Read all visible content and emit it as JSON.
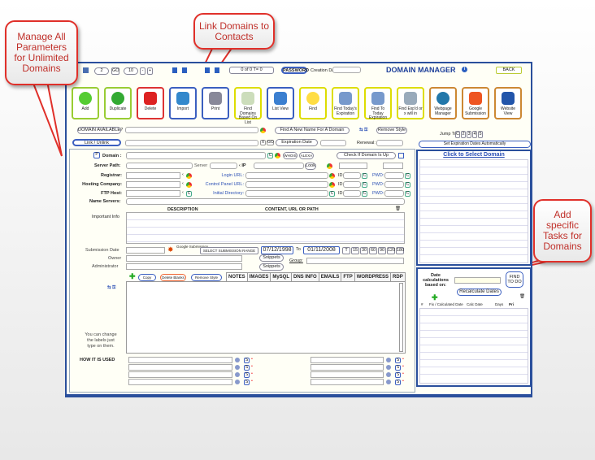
{
  "callouts": {
    "manage": "Manage All Parameters for Unlimited Domains",
    "link": "Link Domains to Contacts",
    "tasks": "Add specific Tasks for Domains"
  },
  "topbar": {
    "page": "2",
    "go": "GO",
    "count": "10",
    "minus": "-",
    "plus": "+",
    "record_status": "0 of 0 T= 0",
    "password": "PASSWORD",
    "creation_date_label": "Creation Date:",
    "title": "DOMAIN MANAGER",
    "info": "i",
    "back": "BACK"
  },
  "toolbar": [
    {
      "label": "Add",
      "icon": "plus-icon",
      "color": "#9c3"
    },
    {
      "label": "Duplicate",
      "icon": "globe-dots-icon",
      "color": "#9c3"
    },
    {
      "label": "Delete",
      "icon": "trash-icon",
      "color": "#d33"
    },
    {
      "label": "Import",
      "icon": "import-icon",
      "color": "#3b5fc0"
    },
    {
      "label": "Print",
      "icon": "printer-icon",
      "color": "#3b5fc0"
    },
    {
      "label": "Find Domains Based On List",
      "icon": "clipboard-icon",
      "color": "#dd0"
    },
    {
      "label": "List View",
      "icon": "window-icon",
      "color": "#3b5fc0"
    },
    {
      "label": "Find",
      "icon": "magnifier-icon",
      "color": "#dd0"
    },
    {
      "label": "Find Today's Expiration",
      "icon": "calendar-icon",
      "color": "#dd0"
    },
    {
      "label": "Find To Today Expiration",
      "icon": "calendar-icon",
      "color": "#dd0"
    },
    {
      "label": "Find Exp'd or  x  will in",
      "icon": "calendar-clock-icon",
      "color": "#dd0"
    },
    {
      "label": "Webpage Manager",
      "icon": "globe-icon",
      "color": "#c83"
    },
    {
      "label": "Google Submission",
      "icon": "sparkle-icon",
      "color": "#c83"
    },
    {
      "label": "Website View",
      "icon": "info-dome-icon",
      "color": "#c83"
    }
  ],
  "form": {
    "domain_available": "DOMAIN AVAILABLE?",
    "find_new_name": "Find A New Name For A Domain",
    "remove_style": "Remove Style",
    "link_unlink": "Link / Unlink",
    "x": "X",
    "go": "GO",
    "expiration_date": "Expiration Date",
    "renewal": "Renewal:",
    "p": "P",
    "domain": "Domain :",
    "c": "C",
    "whois": "WHOIS",
    "alexa": "ALEXA",
    "check_up": "Check If Domain Is Up",
    "server_path": "Server Path:",
    "server": "Server",
    "ip": "IP",
    "look": "Look",
    "registrar": "Registrar:",
    "hosting": "Hosting Company:",
    "ftp_host": "FTP Host:",
    "name_servers": "Name Servers:",
    "login_url": "Login URL:",
    "control_panel_url": "Control Panel URL:",
    "initial_directory": "Initial Directory:",
    "id": "ID",
    "pwd": "PWD:",
    "col_description": "DESCRIPTION",
    "col_content": "CONTENT, URL OR PATH",
    "important_info": "Important Info",
    "submission_date": "Submission Date",
    "google_submission": "Google Submission",
    "select_range": "SELECT SUBMISSION RANGE",
    "range_from": "07/12/1998",
    "to": "To",
    "range_to": "01/11/2008",
    "range_buttons": [
      "T",
      "15",
      "30",
      "60",
      "90",
      "120",
      "180"
    ],
    "owner": "Owner",
    "administrator": "Administrator",
    "snippets": "Snippets",
    "group": "Group:",
    "copy": "Copy",
    "delete_blanks": "Delete Blanks",
    "remove_style2": "Remove Style",
    "tabs": [
      "NOTES",
      "IMAGES",
      "MySQL",
      "DNS INFO",
      "EMAILS",
      "FTP",
      "WORDPRESS",
      "RDP"
    ],
    "hint": "You can change the labels just type on them.",
    "how_used": "HOW IT IS USED",
    "s": "S"
  },
  "right": {
    "jump_to": "Jump To:",
    "jump_buttons": [
      "C",
      "2",
      "3",
      "4",
      "5"
    ],
    "set_exp": "Set Expiration Dates Automatically",
    "select_domain": "Click to Select Domain",
    "date_calc": "Date calculations based on:",
    "find_todo": "FIND TO DO",
    "recalc": "Recalculate Dates",
    "cols": [
      "#",
      "Fix / Calculated Date",
      "Calc Date",
      "Days",
      "Pri"
    ]
  }
}
